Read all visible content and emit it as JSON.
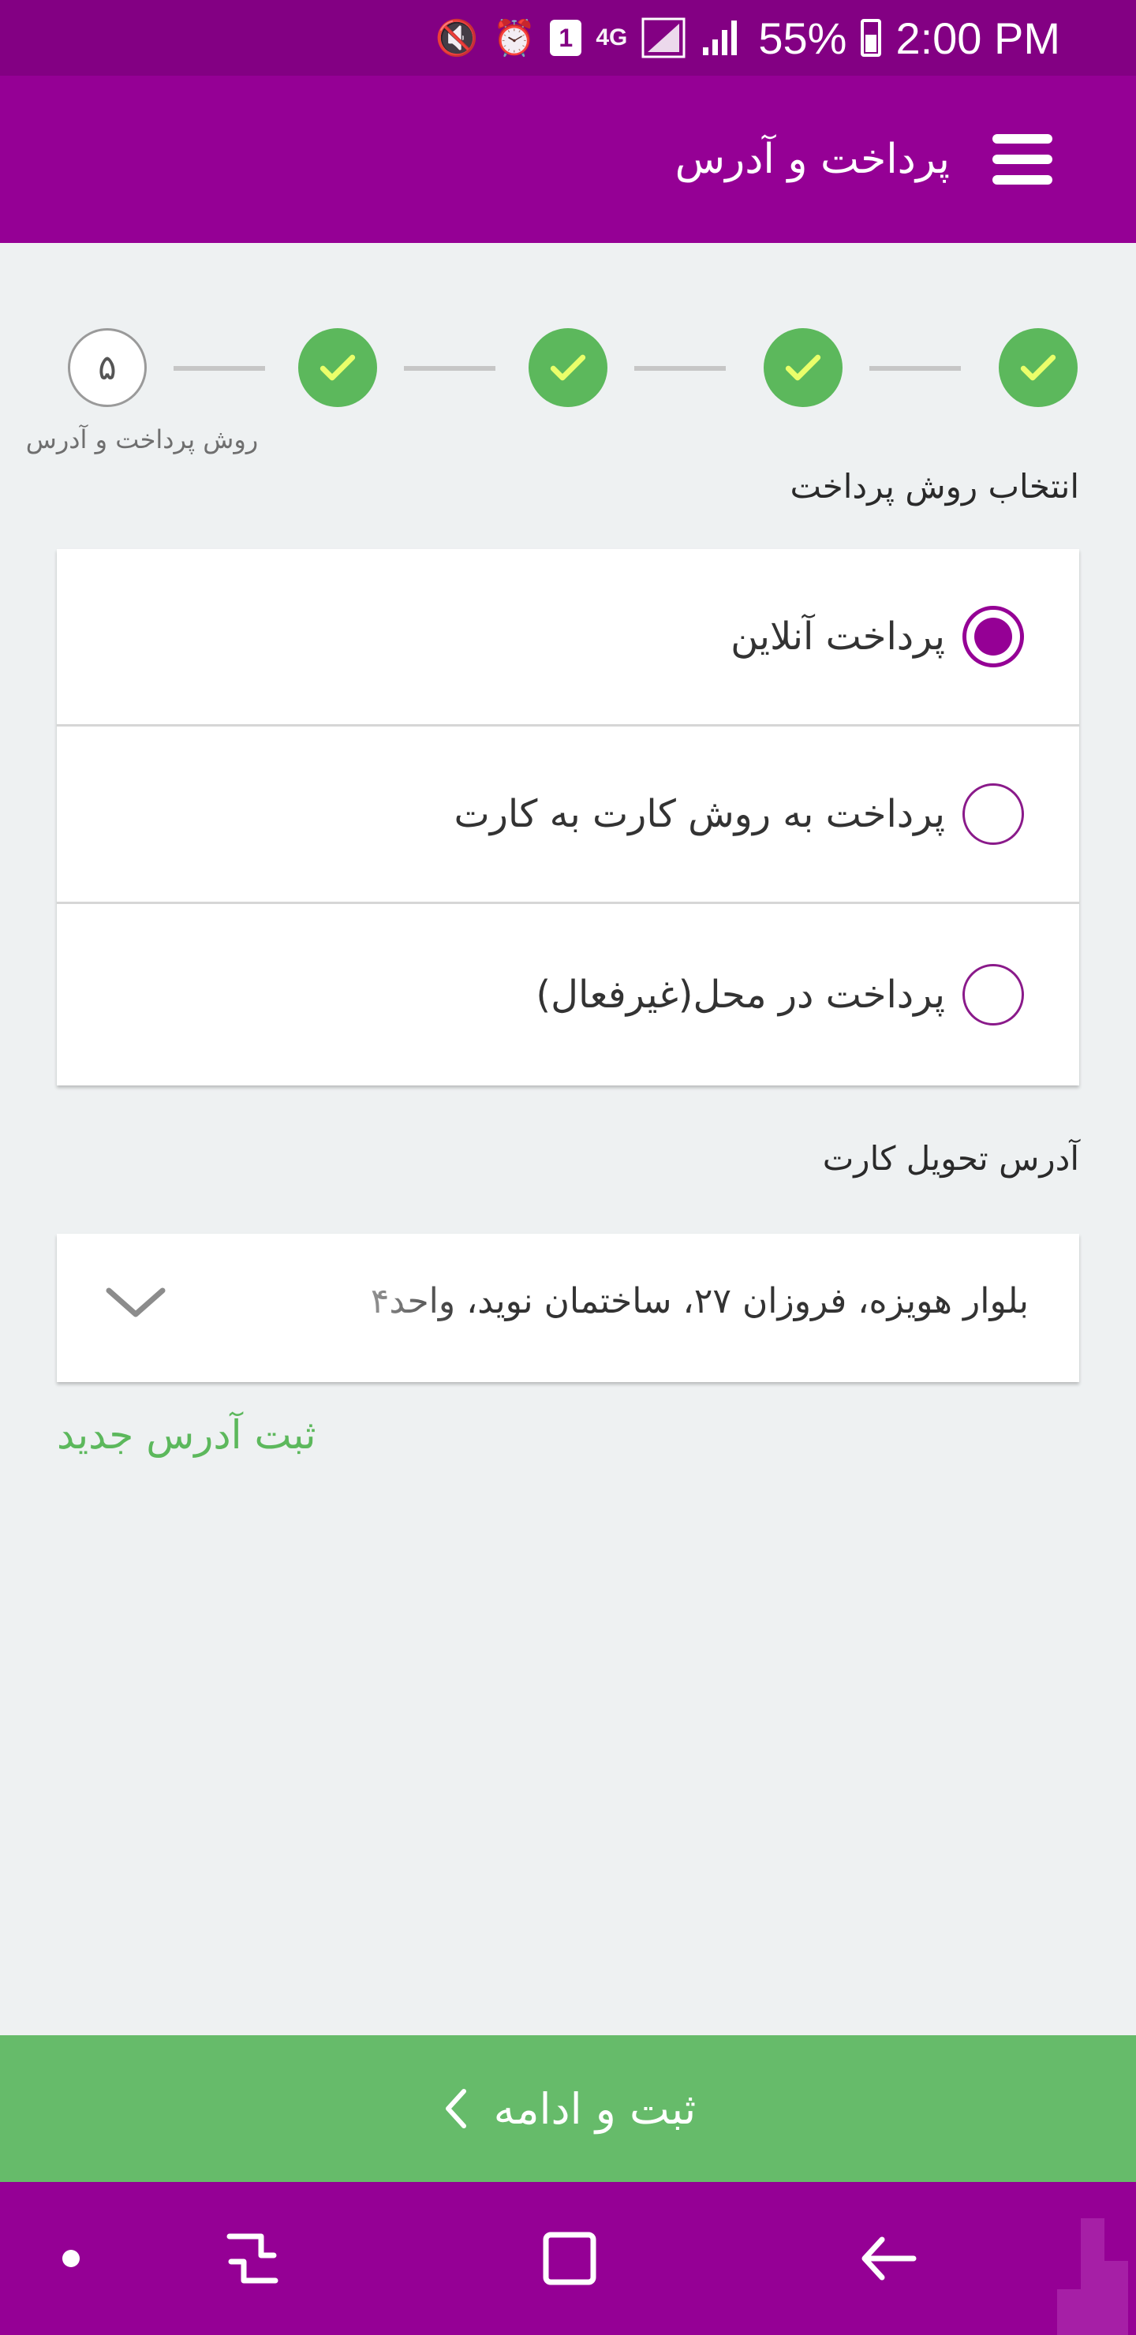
{
  "status_bar": {
    "battery": "55%",
    "time": "2:00 PM",
    "network": "4G",
    "sim_slot": "1",
    "icons": [
      "mute-icon",
      "alarm-icon",
      "sim-icon",
      "network-4g-icon",
      "signal-icon",
      "signal-icon",
      "battery-icon"
    ]
  },
  "app_bar": {
    "title": "پرداخت و آدرس",
    "menu_icon": "hamburger-menu-icon"
  },
  "stepper": {
    "current_step_number": "۵",
    "current_step_label": "روش پرداخت و آدرس",
    "completed_steps": 4,
    "total_steps": 5
  },
  "payment": {
    "section_title": "انتخاب روش پرداخت",
    "options": [
      {
        "label": "پرداخت آنلاین",
        "selected": true
      },
      {
        "label": "پرداخت به روش کارت به کارت",
        "selected": false
      },
      {
        "label": "پرداخت در محل(غیرفعال)",
        "selected": false
      }
    ]
  },
  "address": {
    "section_title": "آدرس تحویل کارت",
    "selected_value": "بلوار هویزه، فروزان ۲۷، ساختمان نوید، واحد۴",
    "new_address_link": "ثبت آدرس جدید"
  },
  "submit": {
    "label": "ثبت و ادامه"
  },
  "colors": {
    "primary": "#950095",
    "status_bar": "#830083",
    "success": "#5cb85c",
    "button": "#66bb6a",
    "background": "#eef1f2"
  }
}
